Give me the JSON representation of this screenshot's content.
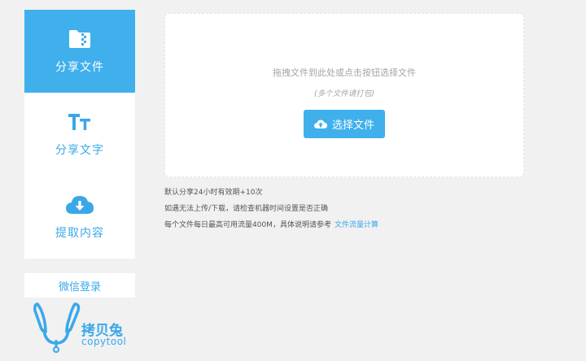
{
  "sidebar": {
    "items": [
      {
        "label": "分享文件",
        "icon": "folder-zip-icon"
      },
      {
        "label": "分享文字",
        "icon": "text-size-icon"
      },
      {
        "label": "提取内容",
        "icon": "cloud-download-icon"
      }
    ],
    "wechat_login": "微信登录"
  },
  "logo": {
    "brand_cn": "拷贝兔",
    "brand_en": "copytool",
    "icon": "rabbit-logo-icon"
  },
  "upload": {
    "hint": "拖拽文件到此处或点击按钮选择文件",
    "sub_hint": "(多个文件请打包)",
    "button_label": "选择文件",
    "button_icon": "cloud-upload-icon"
  },
  "notes": {
    "line1": "默认分享24小时有效期+10次",
    "line2": "如遇无法上传/下载，请检查机器时间设置是否正确",
    "line3": "每个文件每日最高可用流量400M，具体说明请参考",
    "link": "文件流量计算"
  },
  "colors": {
    "accent": "#3fb0ec",
    "background": "#f1f1f1"
  }
}
